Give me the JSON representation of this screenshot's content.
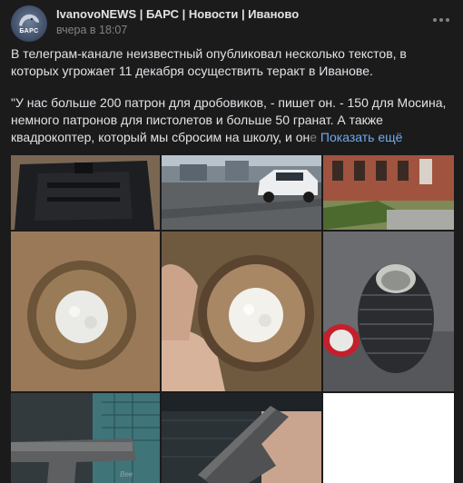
{
  "post": {
    "source_name": "IvanovoNEWS | БАРС | Новости | Иваново",
    "avatar_text": "БАРС",
    "timestamp": "вчера в 18:07",
    "paragraph_1": "В телеграм-канале неизвестный опубликовал несколько текстов, в которых угрожает 11 декабря осуществить теракт в Иванове.",
    "paragraph_2": "\"У нас больше 200 патрон для дробовиков, - пишет он. -  150 для Мосина, немного патронов для пистолетов и больше 50 гранат. А также квадрокоптер, который мы сбросим на школу, и он",
    "paragraph_2_fade": "е",
    "show_more_label": "Показать ещё"
  },
  "photos": [
    {
      "name": "photo-black-backpack",
      "description_icon": "backpack-photo"
    },
    {
      "name": "photo-street-white-car",
      "description_icon": "car-photo"
    },
    {
      "name": "photo-red-brick-building",
      "description_icon": "building-photo"
    },
    {
      "name": "photo-paper-tube-top-1",
      "description_icon": "tube-photo"
    },
    {
      "name": "photo-paper-tube-hand",
      "description_icon": "tube-photo"
    },
    {
      "name": "photo-grenade-bottle",
      "description_icon": "grenade-photo"
    },
    {
      "name": "photo-pistol-1",
      "description_icon": "pistol-photo"
    },
    {
      "name": "photo-pistol-2",
      "description_icon": "pistol-photo"
    }
  ],
  "colors": {
    "background": "#1b1b1c",
    "link": "#71aaeb",
    "secondary_text": "#828282"
  }
}
